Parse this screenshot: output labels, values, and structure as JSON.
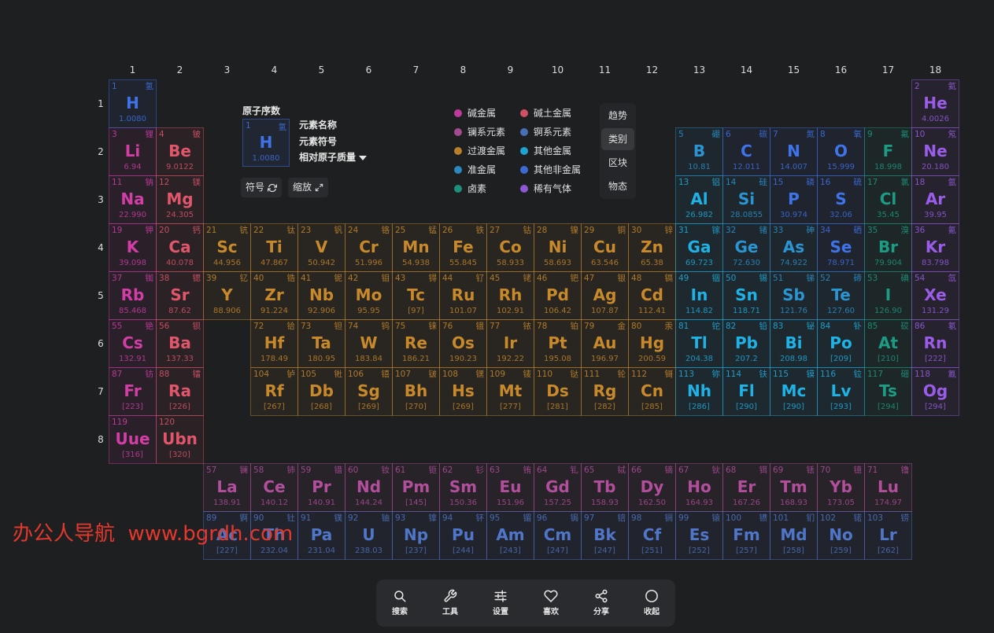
{
  "group_labels": [
    "1",
    "2",
    "3",
    "4",
    "5",
    "6",
    "7",
    "8",
    "9",
    "10",
    "11",
    "12",
    "13",
    "14",
    "15",
    "16",
    "17",
    "18"
  ],
  "period_labels": [
    "1",
    "2",
    "3",
    "4",
    "5",
    "6",
    "7",
    "8"
  ],
  "legend_key": {
    "atomic_number_label": "原子序数",
    "name_label": "元素名称",
    "symbol_label": "元素符号",
    "mass_label": "相对原子质量",
    "sample": {
      "number": "1",
      "name": "氢",
      "symbol": "H",
      "mass": "1.0080"
    },
    "symbol_button": "符号",
    "zoom_button": "缩放"
  },
  "views": [
    {
      "label": "趋势"
    },
    {
      "label": "类别",
      "active": true
    },
    {
      "label": "区块"
    },
    {
      "label": "物态"
    }
  ],
  "categories": [
    {
      "label": "碱金属",
      "color": "#d23ea6",
      "elements": [
        [
          3,
          "Li",
          "锂",
          "6.94"
        ],
        [
          11,
          "Na",
          "钠",
          "22.990"
        ],
        [
          19,
          "K",
          "钾",
          "39.098"
        ],
        [
          37,
          "Rb",
          "铷",
          "85.468"
        ],
        [
          55,
          "Cs",
          "铯",
          "132.91"
        ],
        [
          87,
          "Fr",
          "钫",
          "[223]"
        ],
        [
          119,
          "Uue",
          "",
          "[316]"
        ]
      ]
    },
    {
      "label": "碱土金属",
      "color": "#e2566c",
      "elements": [
        [
          4,
          "Be",
          "铍",
          "9.0122"
        ],
        [
          12,
          "Mg",
          "镁",
          "24.305"
        ],
        [
          20,
          "Ca",
          "钙",
          "40.078"
        ],
        [
          38,
          "Sr",
          "锶",
          "87.62"
        ],
        [
          56,
          "Ba",
          "钡",
          "137.33"
        ],
        [
          88,
          "Ra",
          "镭",
          "[226]"
        ],
        [
          120,
          "Ubn",
          "",
          "[320]"
        ]
      ]
    },
    {
      "label": "镧系元素",
      "color": "#b24f9c",
      "elements": [
        [
          57,
          "La",
          "镧",
          "138.91"
        ],
        [
          58,
          "Ce",
          "铈",
          "140.12"
        ],
        [
          59,
          "Pr",
          "镨",
          "140.91"
        ],
        [
          60,
          "Nd",
          "钕",
          "144.24"
        ],
        [
          61,
          "Pm",
          "钷",
          "[145]"
        ],
        [
          62,
          "Sm",
          "钐",
          "150.36"
        ],
        [
          63,
          "Eu",
          "铕",
          "151.96"
        ],
        [
          64,
          "Gd",
          "钆",
          "157.25"
        ],
        [
          65,
          "Tb",
          "铽",
          "158.93"
        ],
        [
          66,
          "Dy",
          "镝",
          "162.50"
        ],
        [
          67,
          "Ho",
          "钬",
          "164.93"
        ],
        [
          68,
          "Er",
          "铒",
          "167.26"
        ],
        [
          69,
          "Tm",
          "铥",
          "168.93"
        ],
        [
          70,
          "Yb",
          "镱",
          "173.05"
        ],
        [
          71,
          "Lu",
          "镥",
          "174.97"
        ]
      ]
    },
    {
      "label": "锕系元素",
      "color": "#4f76c8",
      "elements": [
        [
          89,
          "Ac",
          "锕",
          "[227]"
        ],
        [
          90,
          "Th",
          "钍",
          "232.04"
        ],
        [
          91,
          "Pa",
          "镤",
          "231.04"
        ],
        [
          92,
          "U",
          "铀",
          "238.03"
        ],
        [
          93,
          "Np",
          "镎",
          "[237]"
        ],
        [
          94,
          "Pu",
          "钚",
          "[244]"
        ],
        [
          95,
          "Am",
          "镅",
          "[243]"
        ],
        [
          96,
          "Cm",
          "锔",
          "[247]"
        ],
        [
          97,
          "Bk",
          "锫",
          "[247]"
        ],
        [
          98,
          "Cf",
          "锎",
          "[251]"
        ],
        [
          99,
          "Es",
          "锿",
          "[252]"
        ],
        [
          100,
          "Fm",
          "镄",
          "[257]"
        ],
        [
          101,
          "Md",
          "钔",
          "[258]"
        ],
        [
          102,
          "No",
          "锘",
          "[259]"
        ],
        [
          103,
          "Lr",
          "铹",
          "[262]"
        ]
      ]
    },
    {
      "label": "过渡金属",
      "color": "#c8892b",
      "elements": [
        [
          21,
          "Sc",
          "钪",
          "44.956"
        ],
        [
          22,
          "Ti",
          "钛",
          "47.867"
        ],
        [
          23,
          "V",
          "钒",
          "50.942"
        ],
        [
          24,
          "Cr",
          "铬",
          "51.996"
        ],
        [
          25,
          "Mn",
          "锰",
          "54.938"
        ],
        [
          26,
          "Fe",
          "铁",
          "55.845"
        ],
        [
          27,
          "Co",
          "钴",
          "58.933"
        ],
        [
          28,
          "Ni",
          "镍",
          "58.693"
        ],
        [
          29,
          "Cu",
          "铜",
          "63.546"
        ],
        [
          30,
          "Zn",
          "锌",
          "65.38"
        ],
        [
          39,
          "Y",
          "钇",
          "88.906"
        ],
        [
          40,
          "Zr",
          "锆",
          "91.224"
        ],
        [
          41,
          "Nb",
          "铌",
          "92.906"
        ],
        [
          42,
          "Mo",
          "钼",
          "95.95"
        ],
        [
          43,
          "Tc",
          "锝",
          "[97]"
        ],
        [
          44,
          "Ru",
          "钌",
          "101.07"
        ],
        [
          45,
          "Rh",
          "铑",
          "102.91"
        ],
        [
          46,
          "Pd",
          "钯",
          "106.42"
        ],
        [
          47,
          "Ag",
          "银",
          "107.87"
        ],
        [
          48,
          "Cd",
          "镉",
          "112.41"
        ],
        [
          72,
          "Hf",
          "铪",
          "178.49"
        ],
        [
          73,
          "Ta",
          "钽",
          "180.95"
        ],
        [
          74,
          "W",
          "钨",
          "183.84"
        ],
        [
          75,
          "Re",
          "铼",
          "186.21"
        ],
        [
          76,
          "Os",
          "锇",
          "190.23"
        ],
        [
          77,
          "Ir",
          "铱",
          "192.22"
        ],
        [
          78,
          "Pt",
          "铂",
          "195.08"
        ],
        [
          79,
          "Au",
          "金",
          "196.97"
        ],
        [
          80,
          "Hg",
          "汞",
          "200.59"
        ],
        [
          104,
          "Rf",
          "𬬻",
          "[267]"
        ],
        [
          105,
          "Db",
          "𬭊",
          "[268]"
        ],
        [
          106,
          "Sg",
          "𬭳",
          "[269]"
        ],
        [
          107,
          "Bh",
          "𬭛",
          "[270]"
        ],
        [
          108,
          "Hs",
          "𬭶",
          "[269]"
        ],
        [
          109,
          "Mt",
          "鿏",
          "[277]"
        ],
        [
          110,
          "Ds",
          "𫟼",
          "[281]"
        ],
        [
          111,
          "Rg",
          "𬬭",
          "[282]"
        ],
        [
          112,
          "Cn",
          "鿔",
          "[285]"
        ]
      ]
    },
    {
      "label": "其他金属",
      "color": "#1fb2e6",
      "elements": [
        [
          13,
          "Al",
          "铝",
          "26.982"
        ],
        [
          31,
          "Ga",
          "镓",
          "69.723"
        ],
        [
          49,
          "In",
          "铟",
          "114.82"
        ],
        [
          50,
          "Sn",
          "锡",
          "118.71"
        ],
        [
          81,
          "Tl",
          "铊",
          "204.38"
        ],
        [
          82,
          "Pb",
          "铅",
          "207.2"
        ],
        [
          83,
          "Bi",
          "铋",
          "208.98"
        ],
        [
          84,
          "Po",
          "钋",
          "[209]"
        ],
        [
          113,
          "Nh",
          "鿭",
          "[286]"
        ],
        [
          114,
          "Fl",
          "𫓧",
          "[290]"
        ],
        [
          115,
          "Mc",
          "镆",
          "[290]"
        ],
        [
          116,
          "Lv",
          "𫟷",
          "[293]"
        ]
      ]
    },
    {
      "label": "准金属",
      "color": "#2a95d2",
      "elements": [
        [
          5,
          "B",
          "硼",
          "10.81"
        ],
        [
          14,
          "Si",
          "硅",
          "28.0855"
        ],
        [
          32,
          "Ge",
          "锗",
          "72.630"
        ],
        [
          33,
          "As",
          "砷",
          "74.922"
        ],
        [
          51,
          "Sb",
          "锑",
          "121.76"
        ],
        [
          52,
          "Te",
          "碲",
          "127.60"
        ]
      ]
    },
    {
      "label": "其他非金属",
      "color": "#3f73ea",
      "elements": [
        [
          1,
          "H",
          "氢",
          "1.0080"
        ],
        [
          6,
          "C",
          "碳",
          "12.011"
        ],
        [
          7,
          "N",
          "氮",
          "14.007"
        ],
        [
          8,
          "O",
          "氧",
          "15.999"
        ],
        [
          15,
          "P",
          "磷",
          "30.974"
        ],
        [
          16,
          "S",
          "硫",
          "32.06"
        ],
        [
          34,
          "Se",
          "硒",
          "78.971"
        ]
      ]
    },
    {
      "label": "卤素",
      "color": "#1c9c84",
      "elements": [
        [
          9,
          "F",
          "氟",
          "18.998"
        ],
        [
          17,
          "Cl",
          "氯",
          "35.45"
        ],
        [
          35,
          "Br",
          "溴",
          "79.904"
        ],
        [
          53,
          "I",
          "碘",
          "126.90"
        ],
        [
          85,
          "At",
          "砹",
          "[210]"
        ],
        [
          117,
          "Ts",
          "鿬",
          "[294]"
        ]
      ]
    },
    {
      "label": "稀有气体",
      "color": "#9b5de9",
      "elements": [
        [
          2,
          "He",
          "氦",
          "4.0026"
        ],
        [
          10,
          "Ne",
          "氖",
          "20.180"
        ],
        [
          18,
          "Ar",
          "氩",
          "39.95"
        ],
        [
          36,
          "Kr",
          "氪",
          "83.798"
        ],
        [
          54,
          "Xe",
          "氙",
          "131.29"
        ],
        [
          86,
          "Rn",
          "氡",
          "[222]"
        ],
        [
          118,
          "Og",
          "鿫",
          "[294]"
        ]
      ]
    }
  ],
  "toolbar": [
    {
      "label": "搜索",
      "icon": "search-icon"
    },
    {
      "label": "工具",
      "icon": "wrench-icon"
    },
    {
      "label": "设置",
      "icon": "sliders-icon"
    },
    {
      "label": "喜欢",
      "icon": "heart-icon"
    },
    {
      "label": "分享",
      "icon": "share-icon"
    },
    {
      "label": "收起",
      "icon": "circle-icon"
    }
  ],
  "watermark": "办公人导航  www.bgrdh.com"
}
